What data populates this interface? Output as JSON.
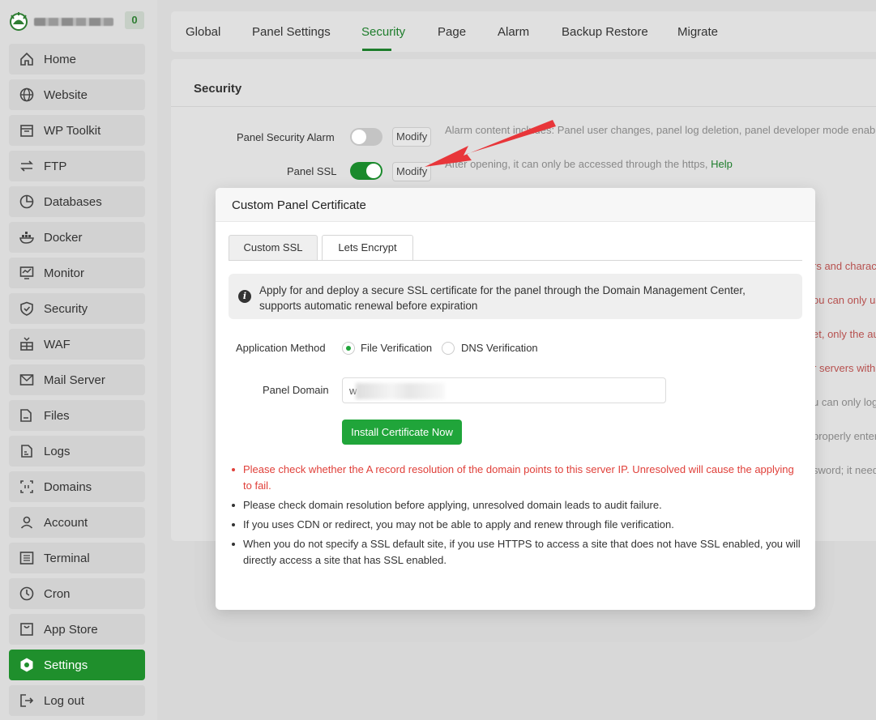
{
  "brand": {
    "badge": "0"
  },
  "sidebar": {
    "items": [
      {
        "label": "Home",
        "icon": "home-icon"
      },
      {
        "label": "Website",
        "icon": "globe-icon"
      },
      {
        "label": "WP Toolkit",
        "icon": "wp-toolkit-icon"
      },
      {
        "label": "FTP",
        "icon": "ftp-icon"
      },
      {
        "label": "Databases",
        "icon": "database-icon"
      },
      {
        "label": "Docker",
        "icon": "docker-icon"
      },
      {
        "label": "Monitor",
        "icon": "monitor-icon"
      },
      {
        "label": "Security",
        "icon": "shield-icon"
      },
      {
        "label": "WAF",
        "icon": "waf-icon"
      },
      {
        "label": "Mail Server",
        "icon": "mail-icon"
      },
      {
        "label": "Files",
        "icon": "folder-icon"
      },
      {
        "label": "Logs",
        "icon": "logs-icon"
      },
      {
        "label": "Domains",
        "icon": "domains-icon"
      },
      {
        "label": "Account",
        "icon": "user-icon"
      },
      {
        "label": "Terminal",
        "icon": "terminal-icon"
      },
      {
        "label": "Cron",
        "icon": "clock-icon"
      },
      {
        "label": "App Store",
        "icon": "app-store-icon"
      },
      {
        "label": "Settings",
        "icon": "settings-icon",
        "active": true
      },
      {
        "label": "Log out",
        "icon": "logout-icon"
      }
    ]
  },
  "tabs": [
    "Global",
    "Panel Settings",
    "Security",
    "Page",
    "Alarm",
    "Backup Restore",
    "Migrate"
  ],
  "active_tab": "Security",
  "card": {
    "title": "Security",
    "rows": {
      "alarm_label": "Panel Security Alarm",
      "alarm_hint": "Alarm content includes: Panel user changes, panel log deletion, panel developer mode enabled",
      "ssl_label": "Panel SSL",
      "ssl_hint": "After opening, it can only be accessed through the https,",
      "ssl_help": "Help",
      "modify": "Modify"
    },
    "fragments_red": [
      "rs and charac",
      "ou can only us",
      "et, only the au",
      "r servers with"
    ],
    "fragments_gray": [
      "u can only log",
      "properly enter",
      "sword; it need"
    ]
  },
  "modal": {
    "title": "Custom Panel Certificate",
    "tabs": {
      "custom": "Custom SSL",
      "lets": "Lets Encrypt"
    },
    "notice": "Apply for and deploy a secure SSL certificate for the panel through the Domain Management Center, supports automatic renewal before expiration",
    "method_label": "Application Method",
    "file_verification": "File Verification",
    "dns_verification": "DNS Verification",
    "domain_label": "Panel Domain",
    "domain_value": "w                    o",
    "install_button": "Install Certificate Now",
    "notes": [
      "Please check whether the A record resolution of the domain points to this server IP. Unresolved will cause the applying to fail.",
      "Please check domain resolution before applying, unresolved domain leads to audit failure.",
      "If you uses CDN or redirect, you may not be able to apply and renew through file verification.",
      "When you do not specify a SSL default site, if you use HTTPS to access a site that does not have SSL enabled, you will directly access a site that has SSL enabled."
    ]
  },
  "colors": {
    "accent": "#20a53a",
    "sidebar_active": "#1f8f2c",
    "warn": "#e0403a",
    "arrow": "#e8363a"
  }
}
